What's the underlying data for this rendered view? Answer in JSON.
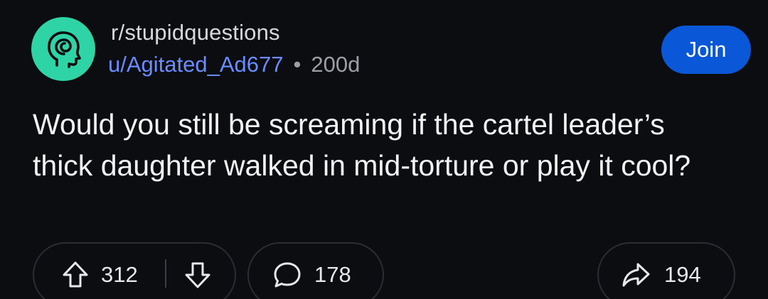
{
  "post": {
    "community": "r/stupidquestions",
    "author": "u/Agitated_Ad677",
    "separator": "•",
    "age": "200d",
    "join_label": "Join",
    "title": "Would you still be screaming if the cartel leader’s thick daughter walked in mid-torture or play it cool?"
  },
  "actions": {
    "upvotes": "312",
    "comments": "178",
    "shares": "194"
  },
  "icons": {
    "avatar": "head-swirl-icon",
    "upvote": "arrow-up-icon",
    "downvote": "arrow-down-icon",
    "comment": "speech-bubble-icon",
    "share": "share-arrow-icon"
  },
  "colors": {
    "background": "#0b0d11",
    "avatar_bg": "#2ed3a6",
    "author": "#6a8cff",
    "join_button": "#0a58d8"
  }
}
